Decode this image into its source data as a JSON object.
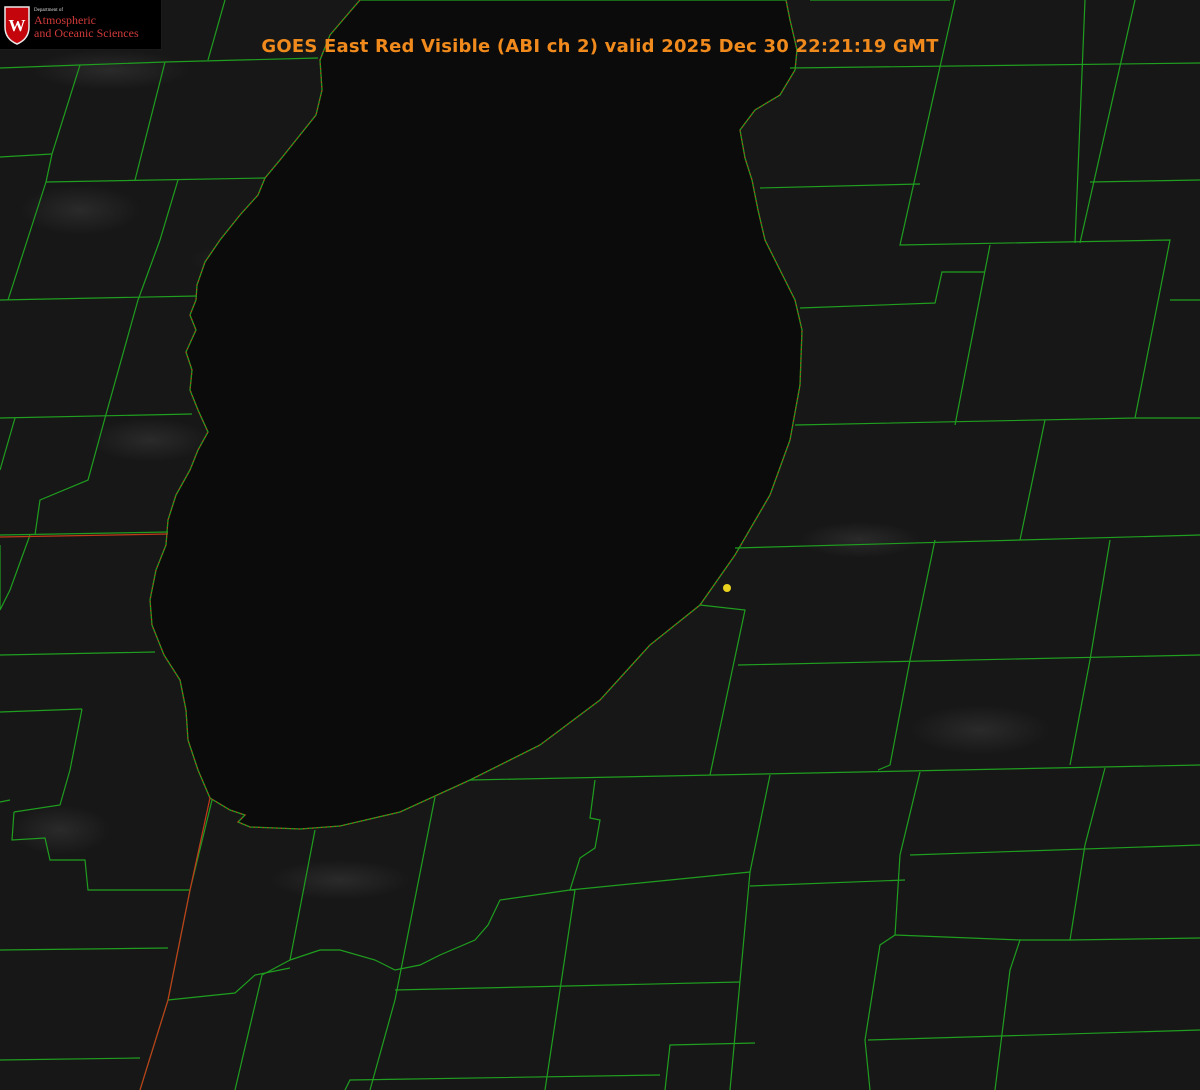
{
  "title": "GOES East Red Visible (ABI ch 2) valid 2025 Dec 30 22:21:19 GMT",
  "logo": {
    "seal_letter": "W",
    "department": "Department of",
    "line1": "Atmospheric",
    "line2": "and Oceanic Sciences"
  },
  "colors": {
    "background": "#000000",
    "lake_fill": "#0b0b0b",
    "land_fill": "#161616",
    "county_lines": "#1f9e1f",
    "state_line": "#c23a1a",
    "title": "#f08a1c",
    "marker": "#e8d21e"
  },
  "map_features": [
    {
      "name": "lake-michigan",
      "type": "water-body"
    },
    {
      "name": "county-boundaries",
      "type": "boundary-lines"
    },
    {
      "name": "state-boundary",
      "type": "boundary-lines"
    },
    {
      "name": "station-marker",
      "type": "point"
    }
  ]
}
